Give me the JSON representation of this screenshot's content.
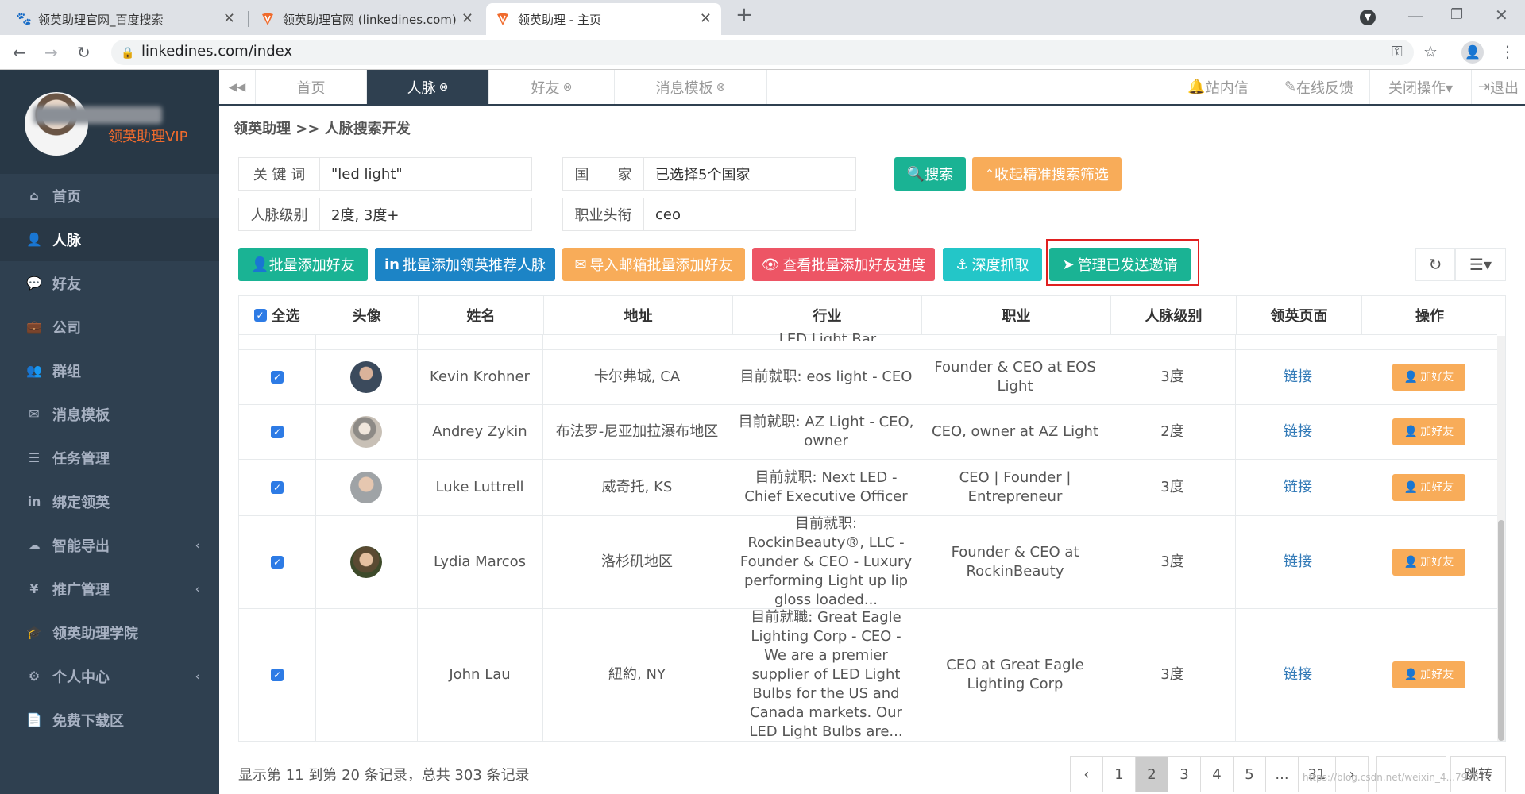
{
  "browser": {
    "tabs": [
      {
        "title": "领英助理官网_百度搜索",
        "close": "✕"
      },
      {
        "title": "领英助理官网 (linkedines.com)",
        "close": "✕"
      },
      {
        "title": "领英助理 - 主页",
        "close": "✕"
      }
    ],
    "new_tab": "+",
    "url": "linkedines.com/index"
  },
  "sidebar": {
    "vip_label": "领英助理VIP",
    "items": [
      {
        "label": "首页",
        "icon": "home-icon",
        "glyph": "⌂"
      },
      {
        "label": "人脉",
        "icon": "user-plus-icon",
        "glyph": "👤"
      },
      {
        "label": "好友",
        "icon": "comments-icon",
        "glyph": "💬"
      },
      {
        "label": "公司",
        "icon": "briefcase-icon",
        "glyph": "💼"
      },
      {
        "label": "群组",
        "icon": "users-icon",
        "glyph": "👥"
      },
      {
        "label": "消息模板",
        "icon": "envelope-icon",
        "glyph": "✉"
      },
      {
        "label": "任务管理",
        "icon": "tasks-icon",
        "glyph": "☰"
      },
      {
        "label": "绑定领英",
        "icon": "linkedin-icon",
        "glyph": "in"
      },
      {
        "label": "智能导出",
        "icon": "cloud-download-icon",
        "glyph": "☁"
      },
      {
        "label": "推广管理",
        "icon": "yen-icon",
        "glyph": "¥"
      },
      {
        "label": "领英助理学院",
        "icon": "graduation-cap-icon",
        "glyph": "🎓"
      },
      {
        "label": "个人中心",
        "icon": "gear-icon",
        "glyph": "⚙"
      },
      {
        "label": "免费下载区",
        "icon": "file-icon",
        "glyph": "📄"
      }
    ],
    "chevron": "‹"
  },
  "topnav": {
    "back_glyph": "◀◀",
    "tabs": [
      "首页",
      "人脉",
      "好友",
      "消息模板"
    ],
    "close_glyph": "⊗",
    "right": [
      "站内信",
      "在线反馈",
      "关闭操作▾",
      "退出"
    ]
  },
  "breadcrumb": {
    "root": "领英助理",
    "sep": ">>",
    "current": "人脉搜索开发"
  },
  "search": {
    "keyword_label": "关 键 词",
    "keyword_value": "\"led light\"",
    "country_label": "国　　家",
    "country_value": "已选择5个国家",
    "level_label": "人脉级别",
    "level_value": "2度, 3度+",
    "title_label": "职业头衔",
    "title_value": "ceo",
    "search_btn": "搜索",
    "collapse_btn": "收起精准搜索筛选"
  },
  "actions": {
    "batch_add": "批量添加好友",
    "batch_add_recommended": "批量添加领英推荐人脉",
    "import_email": "导入邮箱批量添加好友",
    "view_progress": "查看批量添加好友进度",
    "deep_crawl": "深度抓取",
    "manage_invites": "管理已发送邀请"
  },
  "table": {
    "headers": [
      "全选",
      "头像",
      "姓名",
      "地址",
      "行业",
      "职业",
      "人脉级别",
      "领英页面",
      "操作"
    ],
    "partial_text": "LED Light Bar",
    "link_label": "链接",
    "add_label": "加好友",
    "rows": [
      {
        "name": "Kevin Krohner",
        "address": "卡尔弗城, CA",
        "industry": "目前就职: eos light - CEO",
        "job": "Founder & CEO at EOS Light",
        "level": "3度",
        "avatar_color": "#3b4a5c"
      },
      {
        "name": "Andrey Zykin",
        "address": "布法罗-尼亚加拉瀑布地区",
        "industry": "目前就职: AZ Light - CEO, owner",
        "job": "CEO, owner at AZ Light",
        "level": "2度",
        "avatar_color": "#8d8a86"
      },
      {
        "name": "Luke Luttrell",
        "address": "威奇托, KS",
        "industry": "目前就职: Next LED - Chief Executive Officer",
        "job": "CEO | Founder | Entrepreneur",
        "level": "3度",
        "avatar_color": "#9fa3a6"
      },
      {
        "name": "Lydia Marcos",
        "address": "洛杉矶地区",
        "industry": "目前就职: RockinBeauty®, LLC - Founder & CEO - Luxury performing Light up lip gloss loaded...",
        "job": "Founder & CEO at RockinBeauty",
        "level": "3度",
        "avatar_color": "#5a4a32"
      },
      {
        "name": "John Lau",
        "address": "紐約, NY",
        "industry": "目前就職: Great Eagle Lighting Corp - CEO - We are a premier supplier of LED Light Bulbs for the US and Canada markets. Our LED Light Bulbs are...",
        "job": "CEO at Great Eagle Lighting Corp",
        "level": "3度",
        "avatar_color": null
      }
    ]
  },
  "footer": {
    "info": "显示第 11 到第 20 条记录，总共 303 条记录",
    "pages": [
      "‹",
      "1",
      "2",
      "3",
      "4",
      "5",
      "...",
      "31",
      "›"
    ],
    "current_page": "2",
    "jump_label": "跳转",
    "watermark": "https://blog.csdn.net/weixin_4...7975"
  },
  "colors": {
    "sidebar": "#2f4050",
    "green": "#1ab394",
    "orange": "#f8ac59",
    "blue": "#1c84c6",
    "red": "#ed5565",
    "cyan": "#23c6c8",
    "highlight": "#e02020"
  }
}
